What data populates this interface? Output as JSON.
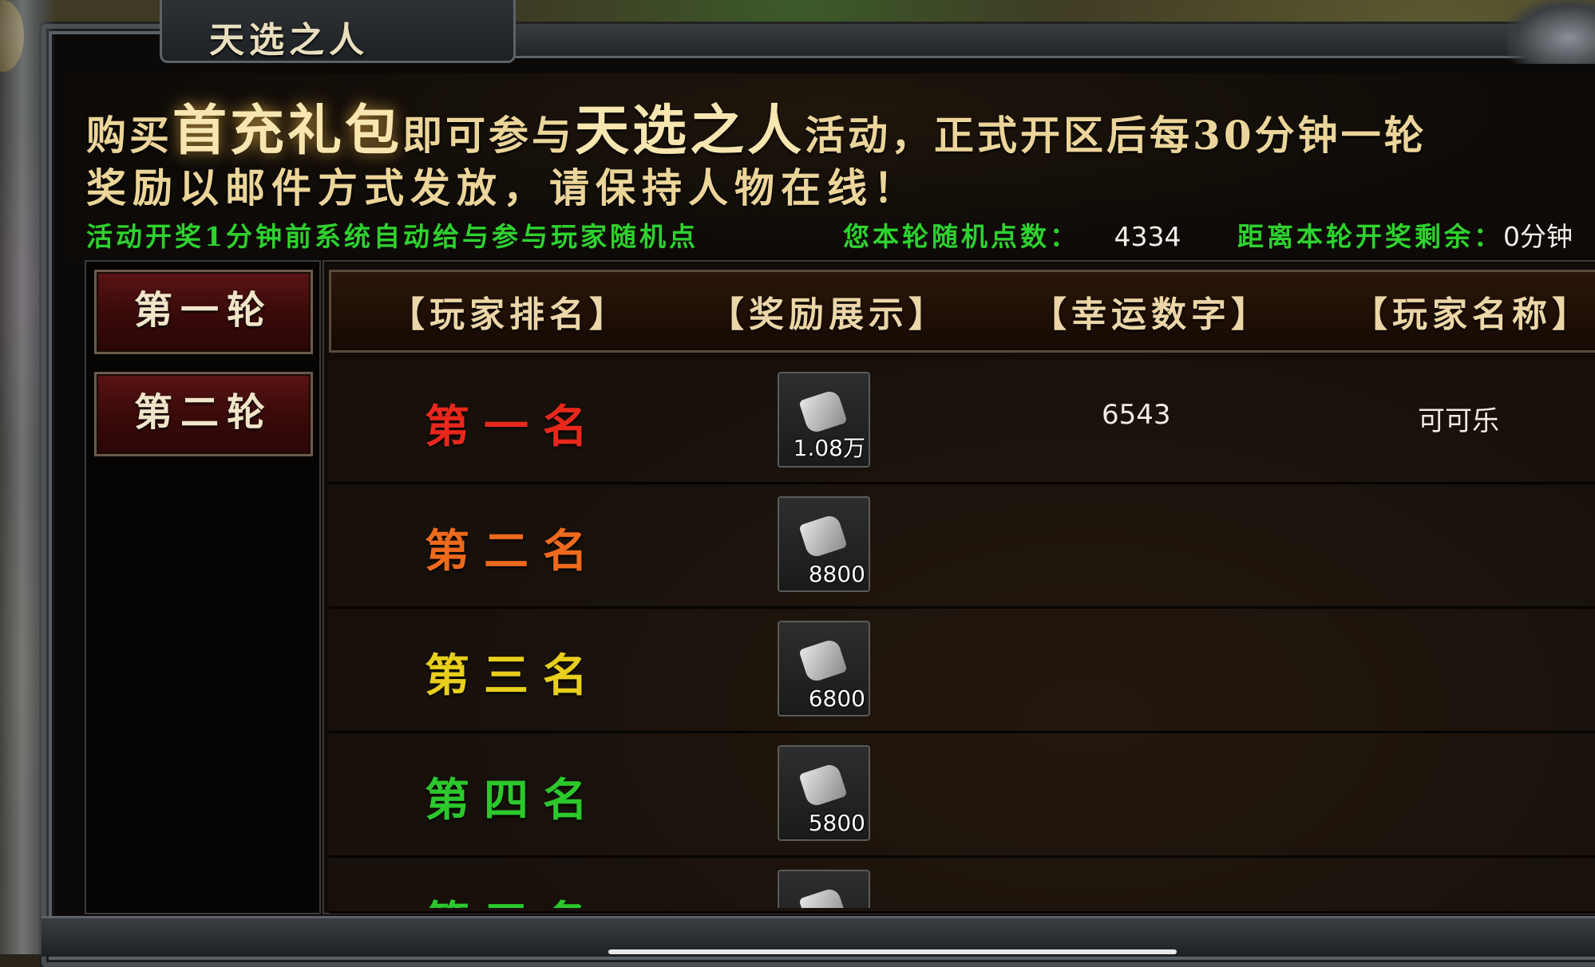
{
  "window": {
    "title": "天选之人"
  },
  "banner": {
    "line1_parts": [
      "购买",
      "首充礼包",
      "即可参与",
      "天选之人",
      "活动，正式开区后每30分钟一轮"
    ],
    "line2": "奖励以邮件方式发放，请保持人物在线！",
    "info_left": "活动开奖1分钟前系统自动给与参与玩家随机点",
    "points_label": "您本轮随机点数：",
    "points_value": "4334",
    "countdown_label": "距离本轮开奖剩余：",
    "countdown_value": "0分钟"
  },
  "rounds": [
    {
      "label": "第一轮"
    },
    {
      "label": "第二轮"
    }
  ],
  "table": {
    "headers": [
      "【玩家排名】",
      "【奖励展示】",
      "【幸运数字】",
      "【玩家名称】"
    ],
    "rows": [
      {
        "rank": "第一名",
        "rank_color": "#e8281c",
        "reward_qty": "1.08万",
        "lucky_number": "6543",
        "player_name": "可可乐"
      },
      {
        "rank": "第二名",
        "rank_color": "#ee6a1c",
        "reward_qty": "8800",
        "lucky_number": "",
        "player_name": ""
      },
      {
        "rank": "第三名",
        "rank_color": "#e8cf1c",
        "reward_qty": "6800",
        "lucky_number": "",
        "player_name": ""
      },
      {
        "rank": "第四名",
        "rank_color": "#2cc82c",
        "reward_qty": "5800",
        "lucky_number": "",
        "player_name": ""
      },
      {
        "rank": "第五名",
        "rank_color": "#2cc82c",
        "reward_qty": "",
        "lucky_number": "",
        "player_name": ""
      }
    ]
  },
  "reward_icon": "scroll-icon"
}
